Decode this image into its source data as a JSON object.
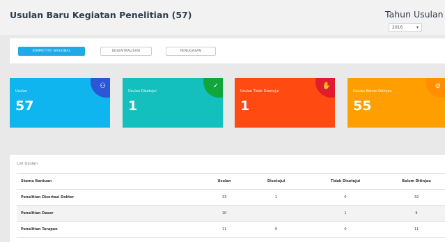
{
  "header": {
    "title": "Usulan Baru Kegiatan Penelitian (57)",
    "year_label": "Tahun Usulan",
    "year_value": "2016"
  },
  "tabs": [
    {
      "label": "Kompetitif Nasional",
      "active": true
    },
    {
      "label": "Desentralisasi",
      "active": false
    },
    {
      "label": "Penugasan",
      "active": false
    }
  ],
  "cards": [
    {
      "label": "Usulan",
      "value": "57",
      "color": "#0fb5ee",
      "corner_color": "#2b56d6",
      "icon": "user-check-icon",
      "glyph": "⚇"
    },
    {
      "label": "Usulan Disetujui",
      "value": "1",
      "color": "#13c0bd",
      "corner_color": "#11a53b",
      "icon": "check-circle-icon",
      "glyph": "✓"
    },
    {
      "label": "Usulan Tidak Disetujui",
      "value": "1",
      "color": "#ff4a12",
      "corner_color": "#e31b2f",
      "icon": "thumbs-down-icon",
      "glyph": "✋"
    },
    {
      "label": "Usulan Belum Ditinjau",
      "value": "55",
      "color": "#ff9e00",
      "corner_color": "#ff8f00",
      "icon": "clock-circle-icon",
      "glyph": "⊘"
    }
  ],
  "list": {
    "title": "List Usulan",
    "columns": [
      "Skema Bantuan",
      "Usulan",
      "Disetujui",
      "Tidak Disetujui",
      "Belum Ditinjau"
    ],
    "rows": [
      [
        "Penelitian Disertasi Doktor",
        "33",
        "1",
        "0",
        "32"
      ],
      [
        "Penelitian Dasar",
        "10",
        "",
        "1",
        "9"
      ],
      [
        "Penelitian Terapan",
        "11",
        "0",
        "0",
        "11"
      ]
    ]
  }
}
